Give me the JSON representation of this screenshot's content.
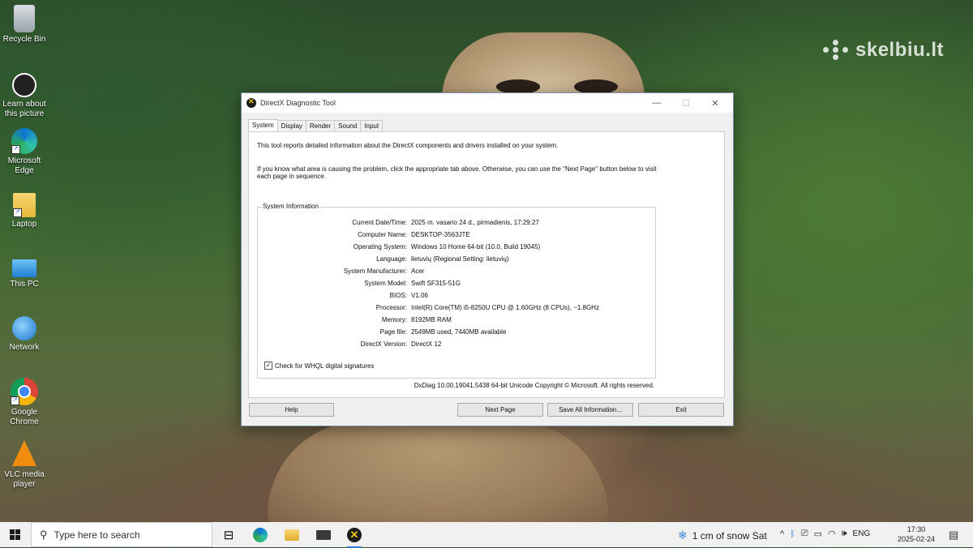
{
  "desktop": {
    "icons": [
      {
        "label": "Recycle Bin",
        "icon": "recycle-bin-icon"
      },
      {
        "label": "Learn about this picture",
        "icon": "learn-picture-icon"
      },
      {
        "label": "Microsoft Edge",
        "icon": "edge-icon"
      },
      {
        "label": "Laptop",
        "icon": "folder-icon"
      },
      {
        "label": "This PC",
        "icon": "this-pc-icon"
      },
      {
        "label": "Network",
        "icon": "network-icon"
      },
      {
        "label": "Google Chrome",
        "icon": "chrome-icon"
      },
      {
        "label": "VLC media player",
        "icon": "vlc-icon"
      }
    ],
    "watermark": "skelbiu.lt"
  },
  "window": {
    "title": "DirectX Diagnostic Tool",
    "tabs": [
      "System",
      "Display",
      "Render",
      "Sound",
      "Input"
    ],
    "active_tab": "System",
    "intro_text": "This tool reports detailed information about the DirectX components and drivers installed on your system.",
    "help_text": "If you know what area is causing the problem, click the appropriate tab above.  Otherwise, you can use the \"Next Page\" button below to visit each page in sequence.",
    "group_title": "System Information",
    "rows": [
      {
        "label": "Current Date/Time:",
        "value": "2025 m. vasario 24 d., pirmadienis, 17:29:27"
      },
      {
        "label": "Computer Name:",
        "value": "DESKTOP-3563JTE"
      },
      {
        "label": "Operating System:",
        "value": "Windows 10 Home 64-bit (10.0, Build 19045)"
      },
      {
        "label": "Language:",
        "value": "lietuvių (Regional Setting: lietuvių)"
      },
      {
        "label": "System Manufacturer:",
        "value": "Acer"
      },
      {
        "label": "System Model:",
        "value": "Swift SF315-51G"
      },
      {
        "label": "BIOS:",
        "value": "V1.06"
      },
      {
        "label": "Processor:",
        "value": "Intel(R) Core(TM) i5-8250U CPU @ 1.60GHz (8 CPUs), ~1.8GHz"
      },
      {
        "label": "Memory:",
        "value": "8192MB RAM"
      },
      {
        "label": "Page file:",
        "value": "2549MB used, 7440MB available"
      },
      {
        "label": "DirectX Version:",
        "value": "DirectX 12"
      }
    ],
    "whql_label": "Check for WHQL digital signatures",
    "whql_checked": true,
    "footer": "DxDiag 10.00.19041.5438 64-bit Unicode  Copyright © Microsoft. All rights reserved.",
    "buttons": {
      "help": "Help",
      "next_page": "Next Page",
      "save_all": "Save All Information...",
      "exit": "Exit"
    }
  },
  "taskbar": {
    "search_placeholder": "Type here to search",
    "weather": "1 cm of snow Sat",
    "language": "ENG",
    "time": "17:30",
    "date": "2025-02-24"
  }
}
